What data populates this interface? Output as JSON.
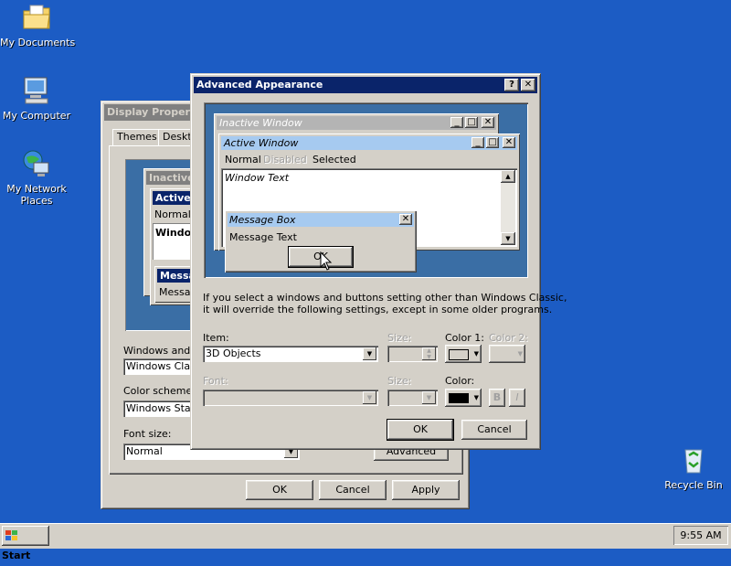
{
  "desktop": {
    "icons": [
      {
        "label": "My Documents"
      },
      {
        "label": "My Computer"
      },
      {
        "label": "My Network\nPlaces"
      },
      {
        "label": "Recycle Bin"
      }
    ]
  },
  "display_properties": {
    "title": "Display Properties",
    "tabs": [
      "Themes",
      "Deskto"
    ],
    "preview": {
      "inactive_title": "Inactive W",
      "active_title": "Active W",
      "menu_normal": "Normal",
      "window_text": "Window",
      "message_title": "Messag",
      "message_text": "Messag"
    },
    "windows_buttons_label": "Windows and b",
    "windows_buttons_value": "Windows Class",
    "color_scheme_label": "Color scheme:",
    "color_scheme_value": "Windows Stan",
    "font_size_label": "Font size:",
    "font_size_value": "Normal",
    "advanced_button": "Advanced",
    "ok": "OK",
    "cancel": "Cancel",
    "apply": "Apply"
  },
  "advanced": {
    "title": "Advanced Appearance",
    "help_glyph": "?",
    "close_glyph": "✕",
    "preview": {
      "inactive_title": "Inactive Window",
      "active_title": "Active Window",
      "menu_normal": "Normal",
      "menu_disabled": "Disabled",
      "menu_selected": "Selected",
      "window_text": "Window Text",
      "message_title": "Message Box",
      "message_text": "Message Text",
      "message_ok": "OK"
    },
    "info_text_line1": "If you select a windows and buttons setting other than Windows Classic,",
    "info_text_line2": "it will override the following settings, except in some older programs.",
    "item_label": "Item:",
    "item_value": "3D Objects",
    "size_label": "Size:",
    "color1_label": "Color 1:",
    "color2_label": "Color 2:",
    "font_label": "Font:",
    "font_size_label": "Size:",
    "font_color_label": "Color:",
    "bold_glyph": "B",
    "italic_glyph": "I",
    "ok": "OK",
    "cancel": "Cancel",
    "colors": {
      "color1": "#d4d0c8",
      "font_color": "#000000"
    }
  },
  "taskbar": {
    "start": "Start",
    "clock": "9:55 AM"
  },
  "colors": {
    "desktop": "#1c5cc4",
    "active_title": "#0a246a",
    "inactive_title": "#808080",
    "preview_bg": "#3a6ea5",
    "preview_active": "#a6caf0"
  }
}
